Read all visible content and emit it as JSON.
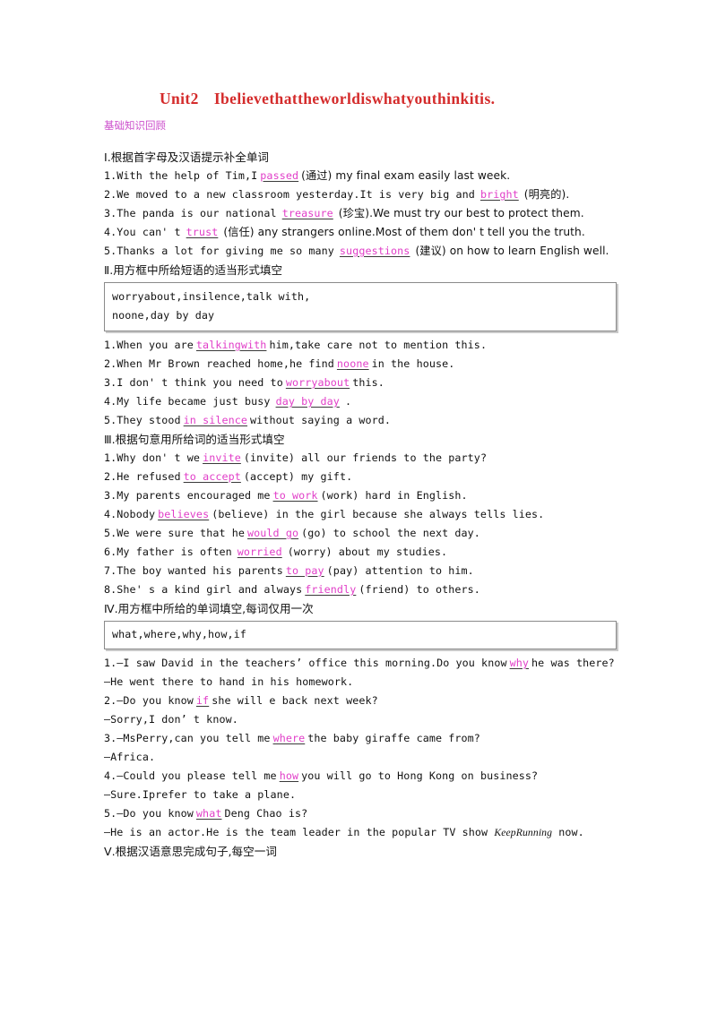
{
  "document": {
    "title_unit": "Unit2",
    "title_text": "Ibelievethattheworldiswhatyouthinkitis.",
    "subtitle": "基础知识回顾",
    "title_color": "#d42b2b",
    "subtitle_color": "#cc4ecc",
    "answer_color": "#e13ec8"
  },
  "section1": {
    "heading": "Ⅰ.根据首字母及汉语提示补全单词",
    "items": [
      {
        "num": "1.",
        "pre": "With the help of Tim,I",
        "answer": "passed",
        "post": "(通过) my final exam easily last week."
      },
      {
        "num": "2.",
        "pre": "We moved to a new classroom yesterday.It is very big and",
        "answer": "bright",
        "post": "(明亮的)."
      },
      {
        "num": "3.",
        "pre": "The panda is our national",
        "answer": "treasure",
        "post": "(珍宝).We must try our best to protect them."
      },
      {
        "num": "4.",
        "pre": "You can' t",
        "answer": "trust",
        "post": "(信任) any strangers online.Most of them don' t tell you the truth."
      },
      {
        "num": "5.",
        "pre": "Thanks a lot for giving me so many",
        "answer": "suggestions",
        "post": "(建议) on how to learn English well."
      }
    ]
  },
  "section2": {
    "heading": "Ⅱ.用方框中所给短语的适当形式填空",
    "wordbank_line1": "worryabout,insilence,talk with,",
    "wordbank_line2": "noone,day by day",
    "items": [
      {
        "num": "1.",
        "pre": "When you are",
        "answer": "talkingwith",
        "post": "him,take care not to mention this."
      },
      {
        "num": "2.",
        "pre": "When Mr Brown reached home,he find",
        "answer": "noone",
        "post": "in the house."
      },
      {
        "num": "3.",
        "pre": "I don' t think you need to",
        "answer": "worryabout",
        "post": "this."
      },
      {
        "num": "4.",
        "pre": "My life became just busy",
        "answer": "day by day",
        "post": "."
      },
      {
        "num": "5.",
        "pre": "They stood",
        "answer": "in silence",
        "post": "without saying a word."
      }
    ]
  },
  "section3": {
    "heading": "Ⅲ.根据句意用所给词的适当形式填空",
    "items": [
      {
        "num": "1.",
        "pre": "Why don' t we",
        "answer": "invite",
        "post": "(invite) all our friends to the party?"
      },
      {
        "num": "2.",
        "pre": "He refused",
        "answer": "to accept",
        "post": "(accept) my gift."
      },
      {
        "num": "3.",
        "pre": "My parents encouraged me",
        "answer": "to work",
        "post": "(work) hard in English."
      },
      {
        "num": "4.",
        "pre": "Nobody",
        "answer": "believes",
        "post": "(believe) in the girl because she always tells lies."
      },
      {
        "num": "5.",
        "pre": "We were sure that he",
        "answer": "would go",
        "post": "(go) to school the next day."
      },
      {
        "num": "6.",
        "pre": "My father is often",
        "answer": "worried",
        "post": "(worry) about my studies."
      },
      {
        "num": "7.",
        "pre": "The boy wanted his parents",
        "answer": "to pay",
        "post": "(pay) attention to him."
      },
      {
        "num": "8.",
        "pre": "She' s a kind girl and always",
        "answer": "friendly",
        "post": "(friend) to others."
      }
    ]
  },
  "section4": {
    "heading": "Ⅳ.用方框中所给的单词填空,每词仅用一次",
    "wordbank_line1": "what,where,why,how,if",
    "items": [
      {
        "num": "1.",
        "pre": "—I saw David in the teachers’  office this morning.Do you know",
        "answer": "why",
        "post": "he was there?",
        "reply": "—He went there to hand in his homework."
      },
      {
        "num": "2.",
        "pre": "—Do you know",
        "answer": "if",
        "post": "she will e back next week?",
        "reply": "—Sorry,I don’ t know."
      },
      {
        "num": "3.",
        "pre": "—MsPerry,can you tell me",
        "answer": "where",
        "post": "the baby giraffe came from?",
        "reply": "—Africa."
      },
      {
        "num": "4.",
        "pre": "—Could you please tell me",
        "answer": "how",
        "post": "you will go to Hong Kong on business?",
        "reply": "—Sure.Iprefer to take a plane."
      },
      {
        "num": "5.",
        "pre": "—Do you know",
        "answer": "what",
        "post": "Deng Chao is?",
        "reply_pre": "—He is an actor.He is the team leader in the popular TV show ",
        "reply_italic": "KeepRunning",
        "reply_post": " now."
      }
    ]
  },
  "section5": {
    "heading": "Ⅴ.根据汉语意思完成句子,每空一词"
  }
}
